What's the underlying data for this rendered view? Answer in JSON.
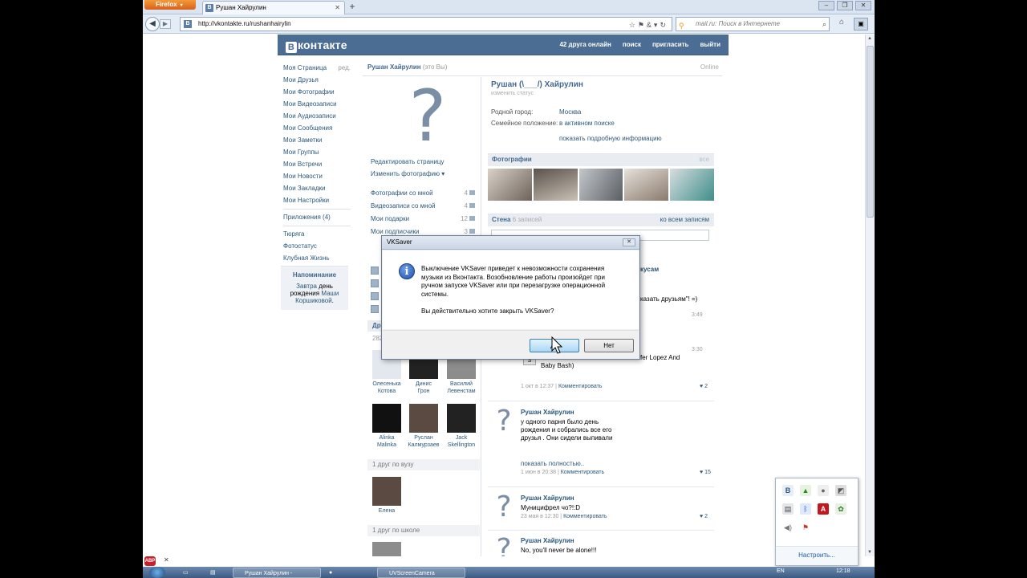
{
  "browser": {
    "firefox_button": "Firefox",
    "tab_title": "Рушан Хайрулин",
    "url": "http://vkontakte.ru/rushanhairylin",
    "search_placeholder": "mail.ru: Поиск в Интернете",
    "window_controls": [
      "–",
      "❐",
      "✕"
    ]
  },
  "vk_header": {
    "logo_letter": "B",
    "logo_text": "контакте",
    "nav": [
      "42 друга онлайн",
      "поиск",
      "пригласить",
      "выйти"
    ]
  },
  "left_menu": {
    "items": [
      "Моя Страница",
      "Мои Друзья",
      "Мои Фотографии",
      "Мои Видеозаписи",
      "Мои Аудиозаписи",
      "Мои Сообщения",
      "Мои Заметки",
      "Мои Группы",
      "Мои Встречи",
      "Мои Новости",
      "Мои Закладки",
      "Мои Настройки"
    ],
    "edit_label": "ред.",
    "apps": "Приложения (4)",
    "apps_extra": [
      "Тюряга",
      "Фотостатус",
      "Клубная Жизнь"
    ]
  },
  "reminder": {
    "title": "Напоминание",
    "text_prefix": "Завтра",
    "text_mid": "день рождения",
    "name": "Маши Коршиковой",
    "suffix": "."
  },
  "profile": {
    "header_name": "Рушан Хайрулин",
    "header_you": "(это Вы)",
    "online": "Online",
    "full_name": "Рушан (\\___/) Хайрулин",
    "status_hint": "изменить статус",
    "edit_page": "Редактировать страницу",
    "change_photo": "Изменить фотографию ▾",
    "counts": [
      {
        "label": "Фотографии со мной",
        "value": "4"
      },
      {
        "label": "Видеозаписи со мной",
        "value": "4"
      },
      {
        "label": "Мои подарки",
        "value": "12"
      },
      {
        "label": "Мои подписчики",
        "value": "3"
      }
    ],
    "info": [
      {
        "key": "Родной город:",
        "value": "Москва"
      },
      {
        "key": "Семейное положение:",
        "value": "в активном поиске"
      }
    ],
    "more_info": "показать подробную информацию"
  },
  "friends": {
    "title": "Др",
    "count_fragment": "282",
    "people": [
      {
        "first": "Олесенька",
        "last": "Котова"
      },
      {
        "first": "Динис",
        "last": "Грон"
      },
      {
        "first": "Василий",
        "last": "Левенстам"
      },
      {
        "first": "Alinka",
        "last": "Malinka"
      },
      {
        "first": "Руслан",
        "last": "Калмурзаев"
      },
      {
        "first": "Jack",
        "last": "Skellington"
      }
    ],
    "university_title": "1 друг по вузу",
    "university_friend": "Елена",
    "school_title": "1 друг по школе"
  },
  "photos_section": {
    "title": "Фотографии",
    "all": "все"
  },
  "wall": {
    "title": "Стена",
    "count": "6 записей",
    "all": "ко всем записям",
    "behind_fragments": {
      "author_end": "кусам",
      "text1": "казать друзьям\"! =)",
      "time1": "3:49",
      "time2": "3:30",
      "text2": "fer Lopez And",
      "text3": "Baby Bash)"
    },
    "post1_meta": "1 окт в 12:37",
    "post1_comment": "Комментировать",
    "post1_likes": "2",
    "posts": [
      {
        "author": "Рушан Хайрулин",
        "text": "у одного парня было день рождения и собрались все его друзья . Они сидели выпивали",
        "more": "показать полностью..",
        "date": "1 июн в 20:38",
        "comment": "Комментировать",
        "likes": "15"
      },
      {
        "author": "Рушан Хайрулин",
        "text": "Муницифрел чо?!:D",
        "date": "23 мая в 12:30",
        "comment": "Комментировать",
        "likes": "2"
      },
      {
        "author": "Рушан Хайрулин",
        "text": "No, you'll never be alone!!!"
      }
    ]
  },
  "dialog": {
    "title": "VKSaver",
    "message": "Выключение VKSaver приведет к невозможности сохранения музыки из Вконтакта. Возобновление работы произойдет при ручном запуске VKSaver или при перезагрузке операционной системы.",
    "question": "Вы действительно хотите закрыть VKSaver?",
    "yes": "Да",
    "no": "Нет"
  },
  "tray_popup": {
    "configure": "Настроить..."
  },
  "taskbar": {
    "items": [
      "Рушан Хайрулин -",
      "UVScreenCamera"
    ],
    "lang": "EN",
    "clock": "12:18"
  },
  "colors": {
    "vk_blue": "#4b6d93",
    "link": "#2b587a",
    "firefox_orange": "#e66e22"
  }
}
